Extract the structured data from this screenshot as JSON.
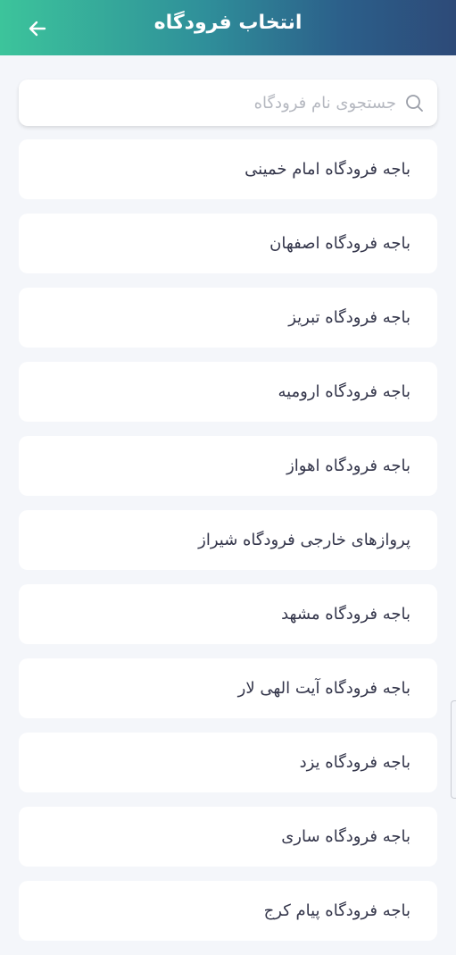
{
  "header": {
    "title": "انتخاب فرودگاه",
    "back_icon": "arrow-left-icon"
  },
  "search": {
    "placeholder": "جستجوی نام فرودگاه",
    "value": "",
    "icon": "search-icon"
  },
  "airports": [
    "باجه فرودگاه امام خمینی",
    "باجه فرودگاه اصفهان",
    "باجه فرودگاه تبریز",
    "باجه فرودگاه ارومیه",
    "باجه فرودگاه اهواز",
    "پروازهای خارجی فرودگاه شیراز",
    "باجه فرودگاه مشهد",
    "باجه فرودگاه آیت الهی لار",
    "باجه فرودگاه یزد",
    "باجه فرودگاه ساری",
    "باجه فرودگاه پیام کرج"
  ],
  "colors": {
    "header_start": "#3cc49b",
    "header_end": "#2d4a78",
    "background": "#f4f6fa",
    "item_text": "#33354a"
  }
}
